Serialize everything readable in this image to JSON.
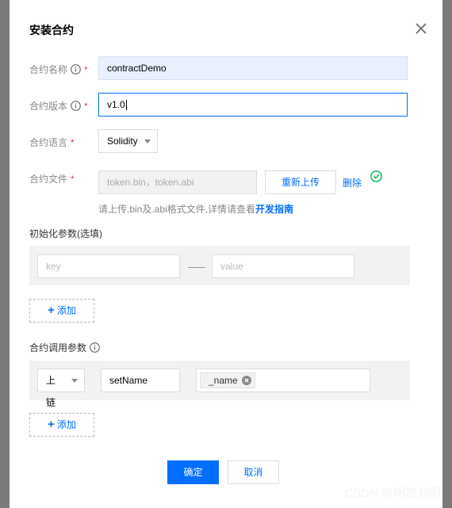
{
  "dialog": {
    "title": "安装合约"
  },
  "form": {
    "name": {
      "label": "合约名称",
      "value": "contractDemo"
    },
    "version": {
      "label": "合约版本",
      "value": "v1.0"
    },
    "language": {
      "label": "合约语言",
      "value": "Solidity"
    },
    "file": {
      "label": "合约文件",
      "placeholder": "token.bin，token.abi",
      "reupload_label": "重新上传",
      "delete_label": "删除",
      "hint_text": "请上传.bin及.abi格式文件,详情请查看",
      "hint_link": "开发指南"
    },
    "required_mark": "*"
  },
  "init_params": {
    "title": "初始化参数(选填)",
    "key_placeholder": "key",
    "value_placeholder": "value",
    "add_label": "添加",
    "add_icon": "+"
  },
  "call_params": {
    "title": "合约调用参数",
    "mode": "上链",
    "method": "setName",
    "arg_tag": "_name",
    "add_label": "添加",
    "add_icon": "+"
  },
  "footer": {
    "confirm_label": "确定",
    "cancel_label": "取消"
  },
  "watermark": "CSDN @明志刘明",
  "colors": {
    "accent": "#006eff",
    "required": "#e54545",
    "success": "#0abf5b",
    "autofill": "#e8f0fe"
  }
}
